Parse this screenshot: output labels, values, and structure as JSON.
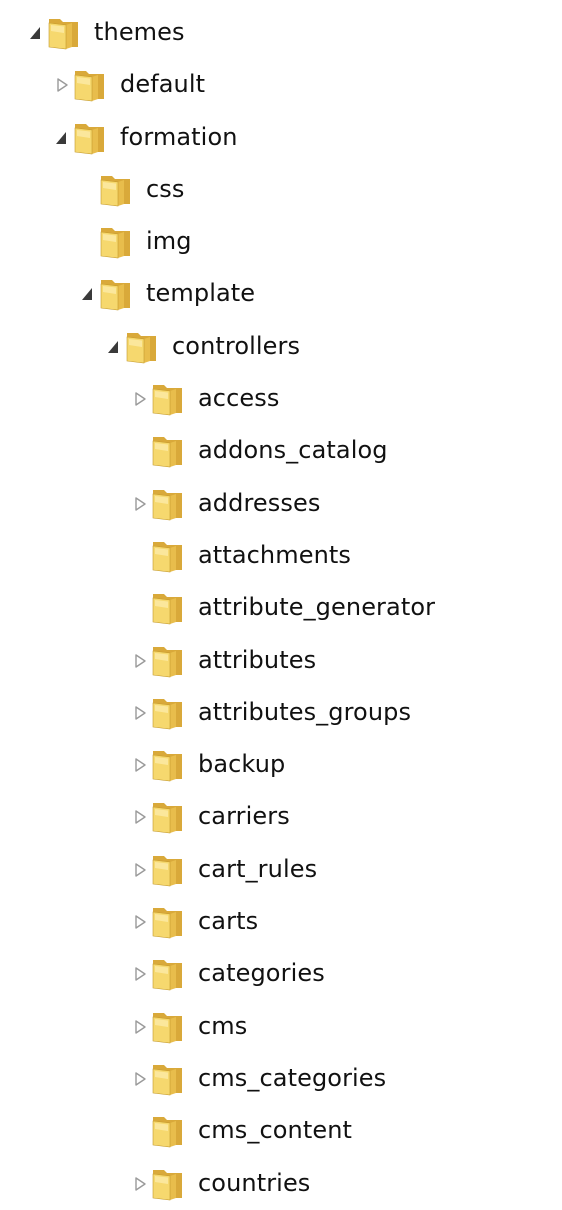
{
  "tree": {
    "items": [
      {
        "label": "themes",
        "depth": 0,
        "state": "expanded",
        "icon": "folder-icon"
      },
      {
        "label": "default",
        "depth": 1,
        "state": "collapsed",
        "icon": "folder-icon"
      },
      {
        "label": "formation",
        "depth": 1,
        "state": "expanded",
        "icon": "folder-icon"
      },
      {
        "label": "css",
        "depth": 2,
        "state": "leaf",
        "icon": "folder-icon"
      },
      {
        "label": "img",
        "depth": 2,
        "state": "leaf",
        "icon": "folder-icon"
      },
      {
        "label": "template",
        "depth": 2,
        "state": "expanded",
        "icon": "folder-icon"
      },
      {
        "label": "controllers",
        "depth": 3,
        "state": "expanded",
        "icon": "folder-icon"
      },
      {
        "label": "access",
        "depth": 4,
        "state": "collapsed",
        "icon": "folder-icon"
      },
      {
        "label": "addons_catalog",
        "depth": 4,
        "state": "leaf",
        "icon": "folder-icon"
      },
      {
        "label": "addresses",
        "depth": 4,
        "state": "collapsed",
        "icon": "folder-icon"
      },
      {
        "label": "attachments",
        "depth": 4,
        "state": "leaf",
        "icon": "folder-icon"
      },
      {
        "label": "attribute_generator",
        "depth": 4,
        "state": "leaf",
        "icon": "folder-icon"
      },
      {
        "label": "attributes",
        "depth": 4,
        "state": "collapsed",
        "icon": "folder-icon"
      },
      {
        "label": "attributes_groups",
        "depth": 4,
        "state": "collapsed",
        "icon": "folder-icon"
      },
      {
        "label": "backup",
        "depth": 4,
        "state": "collapsed",
        "icon": "folder-icon"
      },
      {
        "label": "carriers",
        "depth": 4,
        "state": "collapsed",
        "icon": "folder-icon"
      },
      {
        "label": "cart_rules",
        "depth": 4,
        "state": "collapsed",
        "icon": "folder-icon"
      },
      {
        "label": "carts",
        "depth": 4,
        "state": "collapsed",
        "icon": "folder-icon"
      },
      {
        "label": "categories",
        "depth": 4,
        "state": "collapsed",
        "icon": "folder-icon"
      },
      {
        "label": "cms",
        "depth": 4,
        "state": "collapsed",
        "icon": "folder-icon"
      },
      {
        "label": "cms_categories",
        "depth": 4,
        "state": "collapsed",
        "icon": "folder-icon"
      },
      {
        "label": "cms_content",
        "depth": 4,
        "state": "leaf",
        "icon": "folder-icon"
      },
      {
        "label": "countries",
        "depth": 4,
        "state": "collapsed",
        "icon": "folder-icon"
      }
    ]
  },
  "colors": {
    "folder_back": "#d9a93a",
    "folder_front": "#f6d86e",
    "folder_highlight": "#fbeaa4",
    "expanded_arrow": "#3a3a3a",
    "collapsed_arrow": "#9a9a9a",
    "text": "#111111"
  }
}
